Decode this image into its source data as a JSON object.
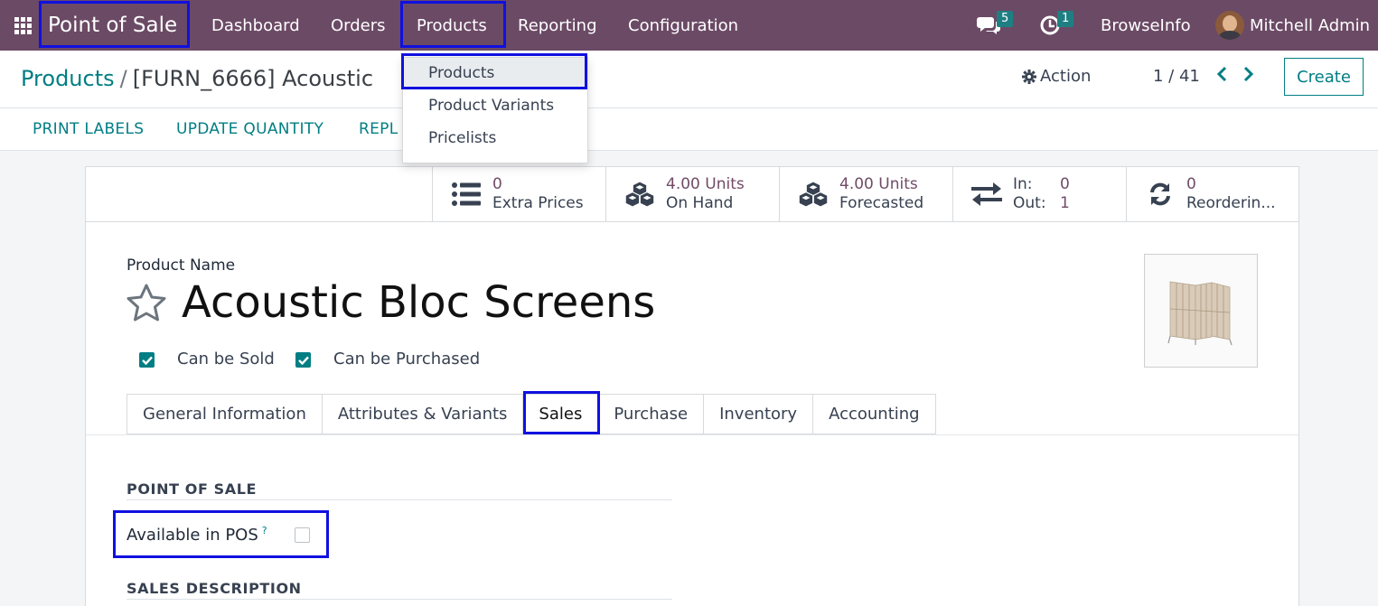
{
  "navbar": {
    "brand": "Point of Sale",
    "menu": [
      "Dashboard",
      "Orders",
      "Products",
      "Reporting",
      "Configuration"
    ],
    "messages_count": "5",
    "activities_count": "1",
    "company": "BrowseInfo",
    "user": "Mitchell Admin"
  },
  "products_dropdown": {
    "items": [
      "Products",
      "Product Variants",
      "Pricelists"
    ]
  },
  "breadcrumb": {
    "parent": "Products",
    "separator": "/",
    "current": "[FURN_6666] Acoustic"
  },
  "control": {
    "action_label": "Action",
    "pager": "1 / 41",
    "create_label": "Create"
  },
  "header_buttons": [
    "PRINT LABELS",
    "UPDATE QUANTITY",
    "REPL"
  ],
  "stats": {
    "extra_prices": {
      "value": "0",
      "label": "Extra Prices"
    },
    "on_hand": {
      "value": "4.00 Units",
      "label": "On Hand"
    },
    "forecasted": {
      "value": "4.00 Units",
      "label": "Forecasted"
    },
    "in_out": {
      "in_label": "In:",
      "in_value": "0",
      "out_label": "Out:",
      "out_value": "1"
    },
    "reordering": {
      "value": "0",
      "label": "Reorderin..."
    }
  },
  "product": {
    "name_label": "Product Name",
    "name": "Acoustic Bloc Screens",
    "can_be_sold": "Can be Sold",
    "can_be_purchased": "Can be Purchased"
  },
  "tabs": [
    "General Information",
    "Attributes & Variants",
    "Sales",
    "Purchase",
    "Inventory",
    "Accounting"
  ],
  "sales_tab": {
    "pos_section": "POINT OF SALE",
    "available_in_pos": "Available in POS",
    "help_mark": "?",
    "sales_description_section": "SALES DESCRIPTION"
  },
  "colors": {
    "navbar": "#6b4a65",
    "primary": "#017e84",
    "stat_value": "#714b67",
    "highlight": "#1010e0"
  },
  "icons": [
    "apps-grid-icon",
    "chat-icon",
    "clock-icon",
    "gear-icon",
    "chevron-left-icon",
    "chevron-right-icon",
    "list-icon",
    "cubes-icon",
    "exchange-icon",
    "refresh-icon",
    "star-icon",
    "check-icon"
  ]
}
